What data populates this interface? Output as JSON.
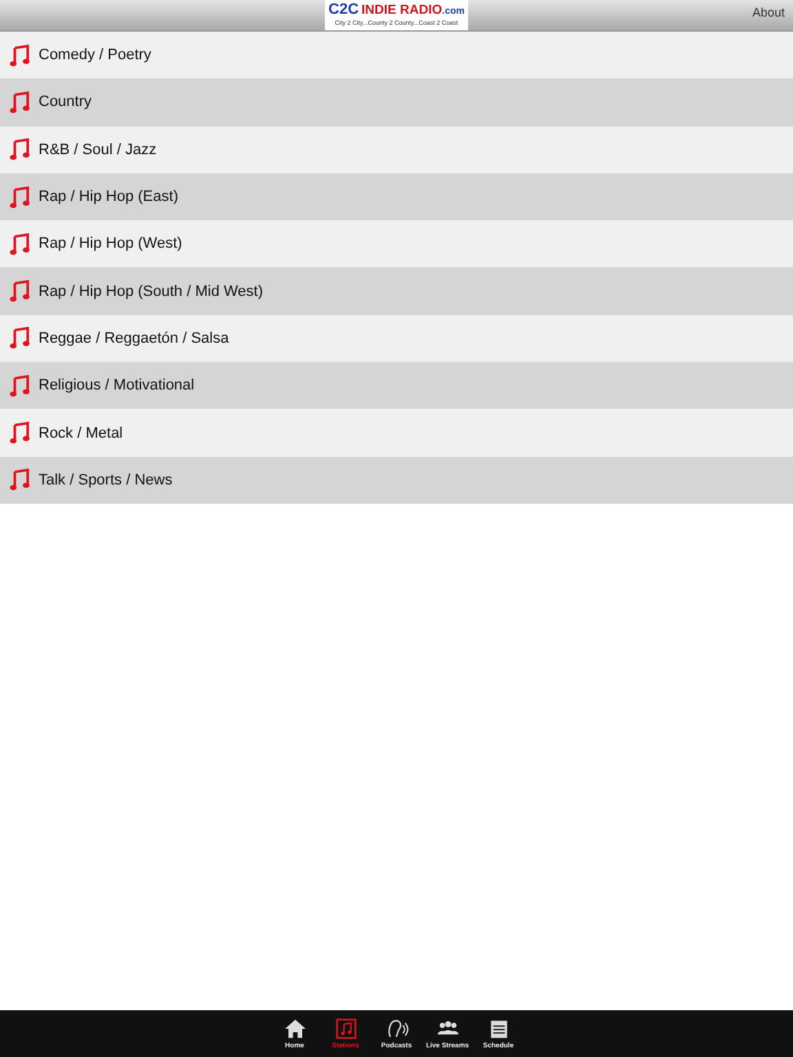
{
  "header": {
    "logo": {
      "mark": "C2C",
      "name": "INDIE RADIO",
      "suffix": ".com",
      "tagline": "City 2 City...County 2 County...Coast 2 Coast"
    },
    "about": "About"
  },
  "genres": [
    {
      "label": "Comedy / Poetry"
    },
    {
      "label": "Country"
    },
    {
      "label": "R&B / Soul / Jazz"
    },
    {
      "label": "Rap / Hip Hop (East)"
    },
    {
      "label": "Rap / Hip Hop (West)"
    },
    {
      "label": "Rap / Hip Hop (South / Mid West)"
    },
    {
      "label": "Reggae / Reggaetón / Salsa"
    },
    {
      "label": "Religious / Motivational"
    },
    {
      "label": "Rock / Metal"
    },
    {
      "label": "Talk / Sports / News"
    }
  ],
  "tabs": [
    {
      "label": "Home",
      "kind": "home",
      "selected": false
    },
    {
      "label": "Stations",
      "kind": "stations",
      "selected": true
    },
    {
      "label": "Podcasts",
      "kind": "podcasts",
      "selected": false
    },
    {
      "label": "Live Streams",
      "kind": "streams",
      "selected": false
    },
    {
      "label": "Schedule",
      "kind": "schedule",
      "selected": false
    }
  ]
}
